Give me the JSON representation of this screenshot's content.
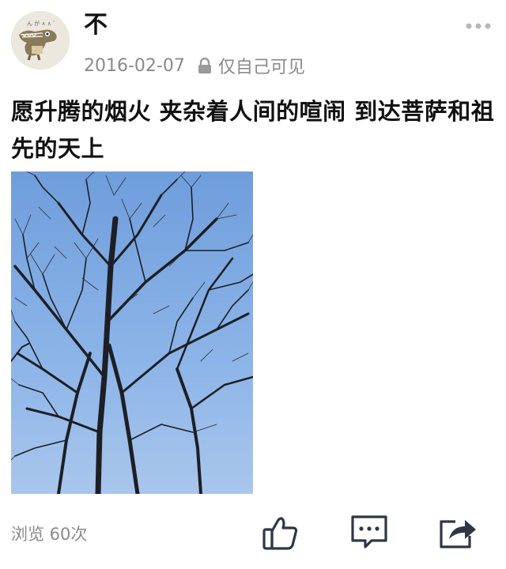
{
  "post": {
    "username": "不",
    "date": "2016-02-07",
    "visibility": "仅自己可见",
    "text": "愿升腾的烟火 夹杂着人间的喧闹 到达菩萨和祖先的天上",
    "views_label": "浏览 60次"
  },
  "icons": {
    "more": "more-dots-icon",
    "lock": "lock-icon",
    "like": "thumbs-up-icon",
    "comment": "comment-icon",
    "share": "share-icon"
  },
  "colors": {
    "text": "#111111",
    "muted": "#8a8a8a",
    "icon_dark": "#2f3747",
    "sky": "#7fa9e1"
  }
}
